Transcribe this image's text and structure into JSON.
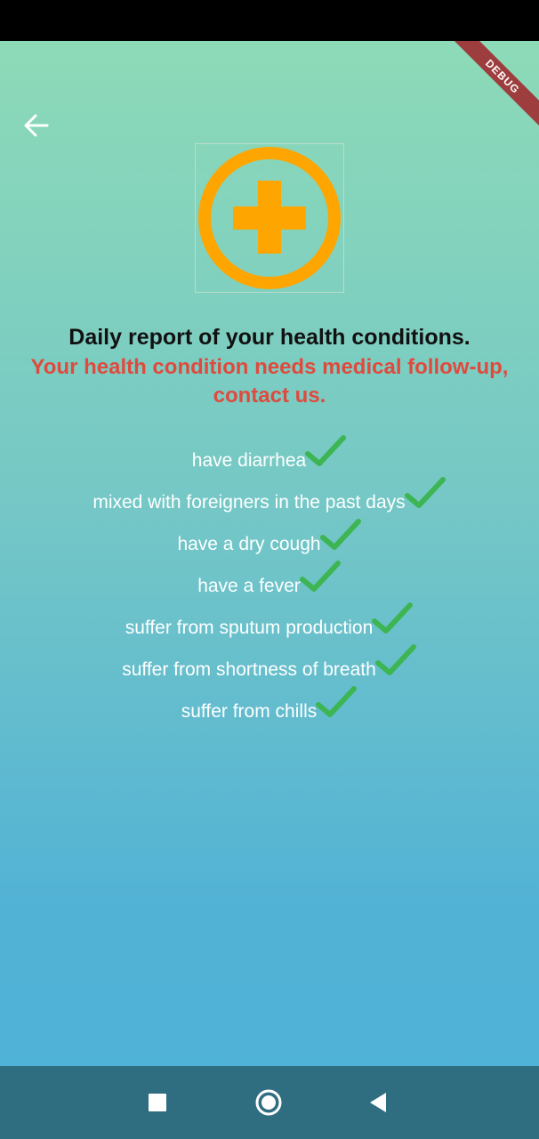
{
  "debug_label": "DEBUG",
  "header": {
    "back_icon": "arrow-left-icon",
    "logo_icon": "plus-circle-icon"
  },
  "report": {
    "title": "Daily report of your health conditions.",
    "alert": "Your health condition needs medical follow-up, contact us."
  },
  "symptoms": [
    "have diarrhea",
    "mixed with foreigners in the past days",
    "have a dry cough",
    "have a fever",
    "suffer from sputum production",
    "suffer from shortness of breath",
    "suffer from chills"
  ],
  "colors": {
    "logo": "#FFA500",
    "alert": "#E04A3E",
    "check": "#3DB553",
    "nav_bar": "#2F6D80"
  },
  "nav": {
    "recents_icon": "square-icon",
    "home_icon": "circle-icon",
    "back_icon": "triangle-back-icon"
  }
}
